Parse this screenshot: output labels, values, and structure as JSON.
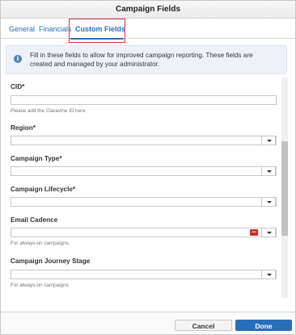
{
  "dialog": {
    "title": "Campaign Fields"
  },
  "tabs": [
    {
      "label": "General"
    },
    {
      "label": "Financials"
    },
    {
      "label": "Custom Fields"
    }
  ],
  "info": {
    "icon": "info-icon",
    "text": "Fill in these fields to allow for improved campaign reporting. These fields are created and managed by your administrator."
  },
  "fields": {
    "cid": {
      "label": "CID*",
      "value": "",
      "hint": "Please add the Claravine ID here"
    },
    "region": {
      "label": "Region*",
      "value": ""
    },
    "campaign_type": {
      "label": "Campaign Type*",
      "value": ""
    },
    "campaign_lifecycle": {
      "label": "Campaign Lifecycle*",
      "value": ""
    },
    "email_cadence": {
      "label": "Email Cadence",
      "value": "",
      "hint": "For always-on campaigns.",
      "badge": "•••"
    },
    "journey_stage": {
      "label": "Campaign Journey Stage",
      "value": "",
      "hint": "For always-on campaigns"
    }
  },
  "footer": {
    "cancel_label": "Cancel",
    "done_label": "Done"
  },
  "colors": {
    "accent": "#2a6ebb",
    "highlight": "#d3343f"
  }
}
